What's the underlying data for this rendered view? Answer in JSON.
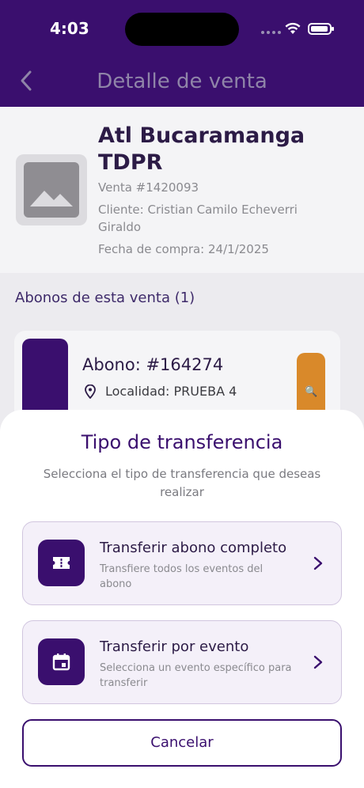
{
  "status_bar": {
    "time": "4:03"
  },
  "nav": {
    "title": "Detalle de venta"
  },
  "sale": {
    "name": "Atl Bucaramanga TDPR",
    "number": "Venta #1420093",
    "client": "Cliente: Cristian Camilo Echeverri Giraldo",
    "date": "Fecha de compra: 24/1/2025"
  },
  "abonos_section": {
    "title": "Abonos de esta venta (1)"
  },
  "abono": {
    "number": "Abono: #164274",
    "location": "Localidad: PRUEBA  4"
  },
  "sheet": {
    "title": "Tipo de transferencia",
    "subtitle": "Selecciona el tipo de transferencia que deseas realizar",
    "options": [
      {
        "title": "Transferir abono completo",
        "description": "Transfiere todos los eventos del abono",
        "icon": "ticket-icon"
      },
      {
        "title": "Transferir por evento",
        "description": "Selecciona un evento específico para transferir",
        "icon": "calendar-icon"
      }
    ],
    "cancel_label": "Cancelar"
  },
  "colors": {
    "primary": "#3a0f6e",
    "accent_orange": "#d9892a",
    "option_bg": "#f4f0f9"
  }
}
